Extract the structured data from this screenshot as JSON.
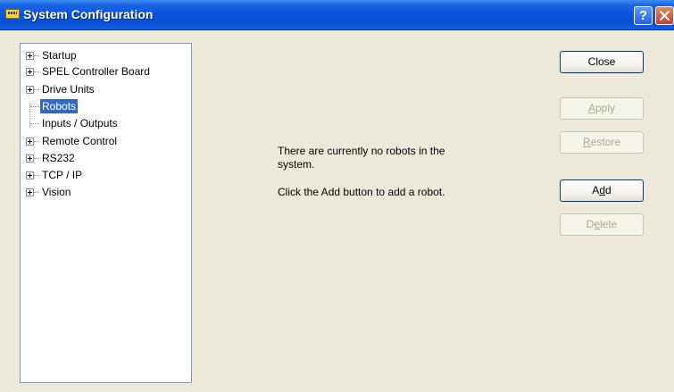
{
  "window": {
    "title": "System Configuration",
    "help_glyph": "?",
    "app_icon": "controller-icon",
    "close_icon": "close-icon"
  },
  "tree": {
    "items": [
      {
        "label": "Startup",
        "expandable": true
      },
      {
        "label": "SPEL Controller Board",
        "expandable": true
      },
      {
        "label": "Drive Units",
        "expandable": true
      },
      {
        "label": "Robots",
        "expandable": false,
        "selected": true
      },
      {
        "label": "Inputs / Outputs",
        "expandable": false
      },
      {
        "label": "Remote Control",
        "expandable": true
      },
      {
        "label": "RS232",
        "expandable": true
      },
      {
        "label": "TCP / IP",
        "expandable": true
      },
      {
        "label": "Vision",
        "expandable": true
      }
    ]
  },
  "content": {
    "message_line1": "There are currently no robots in the",
    "message_line2": "system.",
    "message_line3": "Click the Add button to add a robot."
  },
  "buttons": {
    "close": {
      "label": "Close",
      "enabled": true
    },
    "apply": {
      "pre": "",
      "mnemonic": "A",
      "post": "pply",
      "enabled": false
    },
    "restore": {
      "pre": "",
      "mnemonic": "R",
      "post": "estore",
      "enabled": false
    },
    "add": {
      "pre": "A",
      "mnemonic": "d",
      "post": "d",
      "enabled": true
    },
    "delete": {
      "pre": "D",
      "mnemonic": "e",
      "post": "lete",
      "enabled": false
    }
  },
  "colors": {
    "titlebar": "#0a55dd",
    "dialog_bg": "#ece9d8",
    "selection": "#316ac5",
    "disabled_text": "#aca899"
  }
}
